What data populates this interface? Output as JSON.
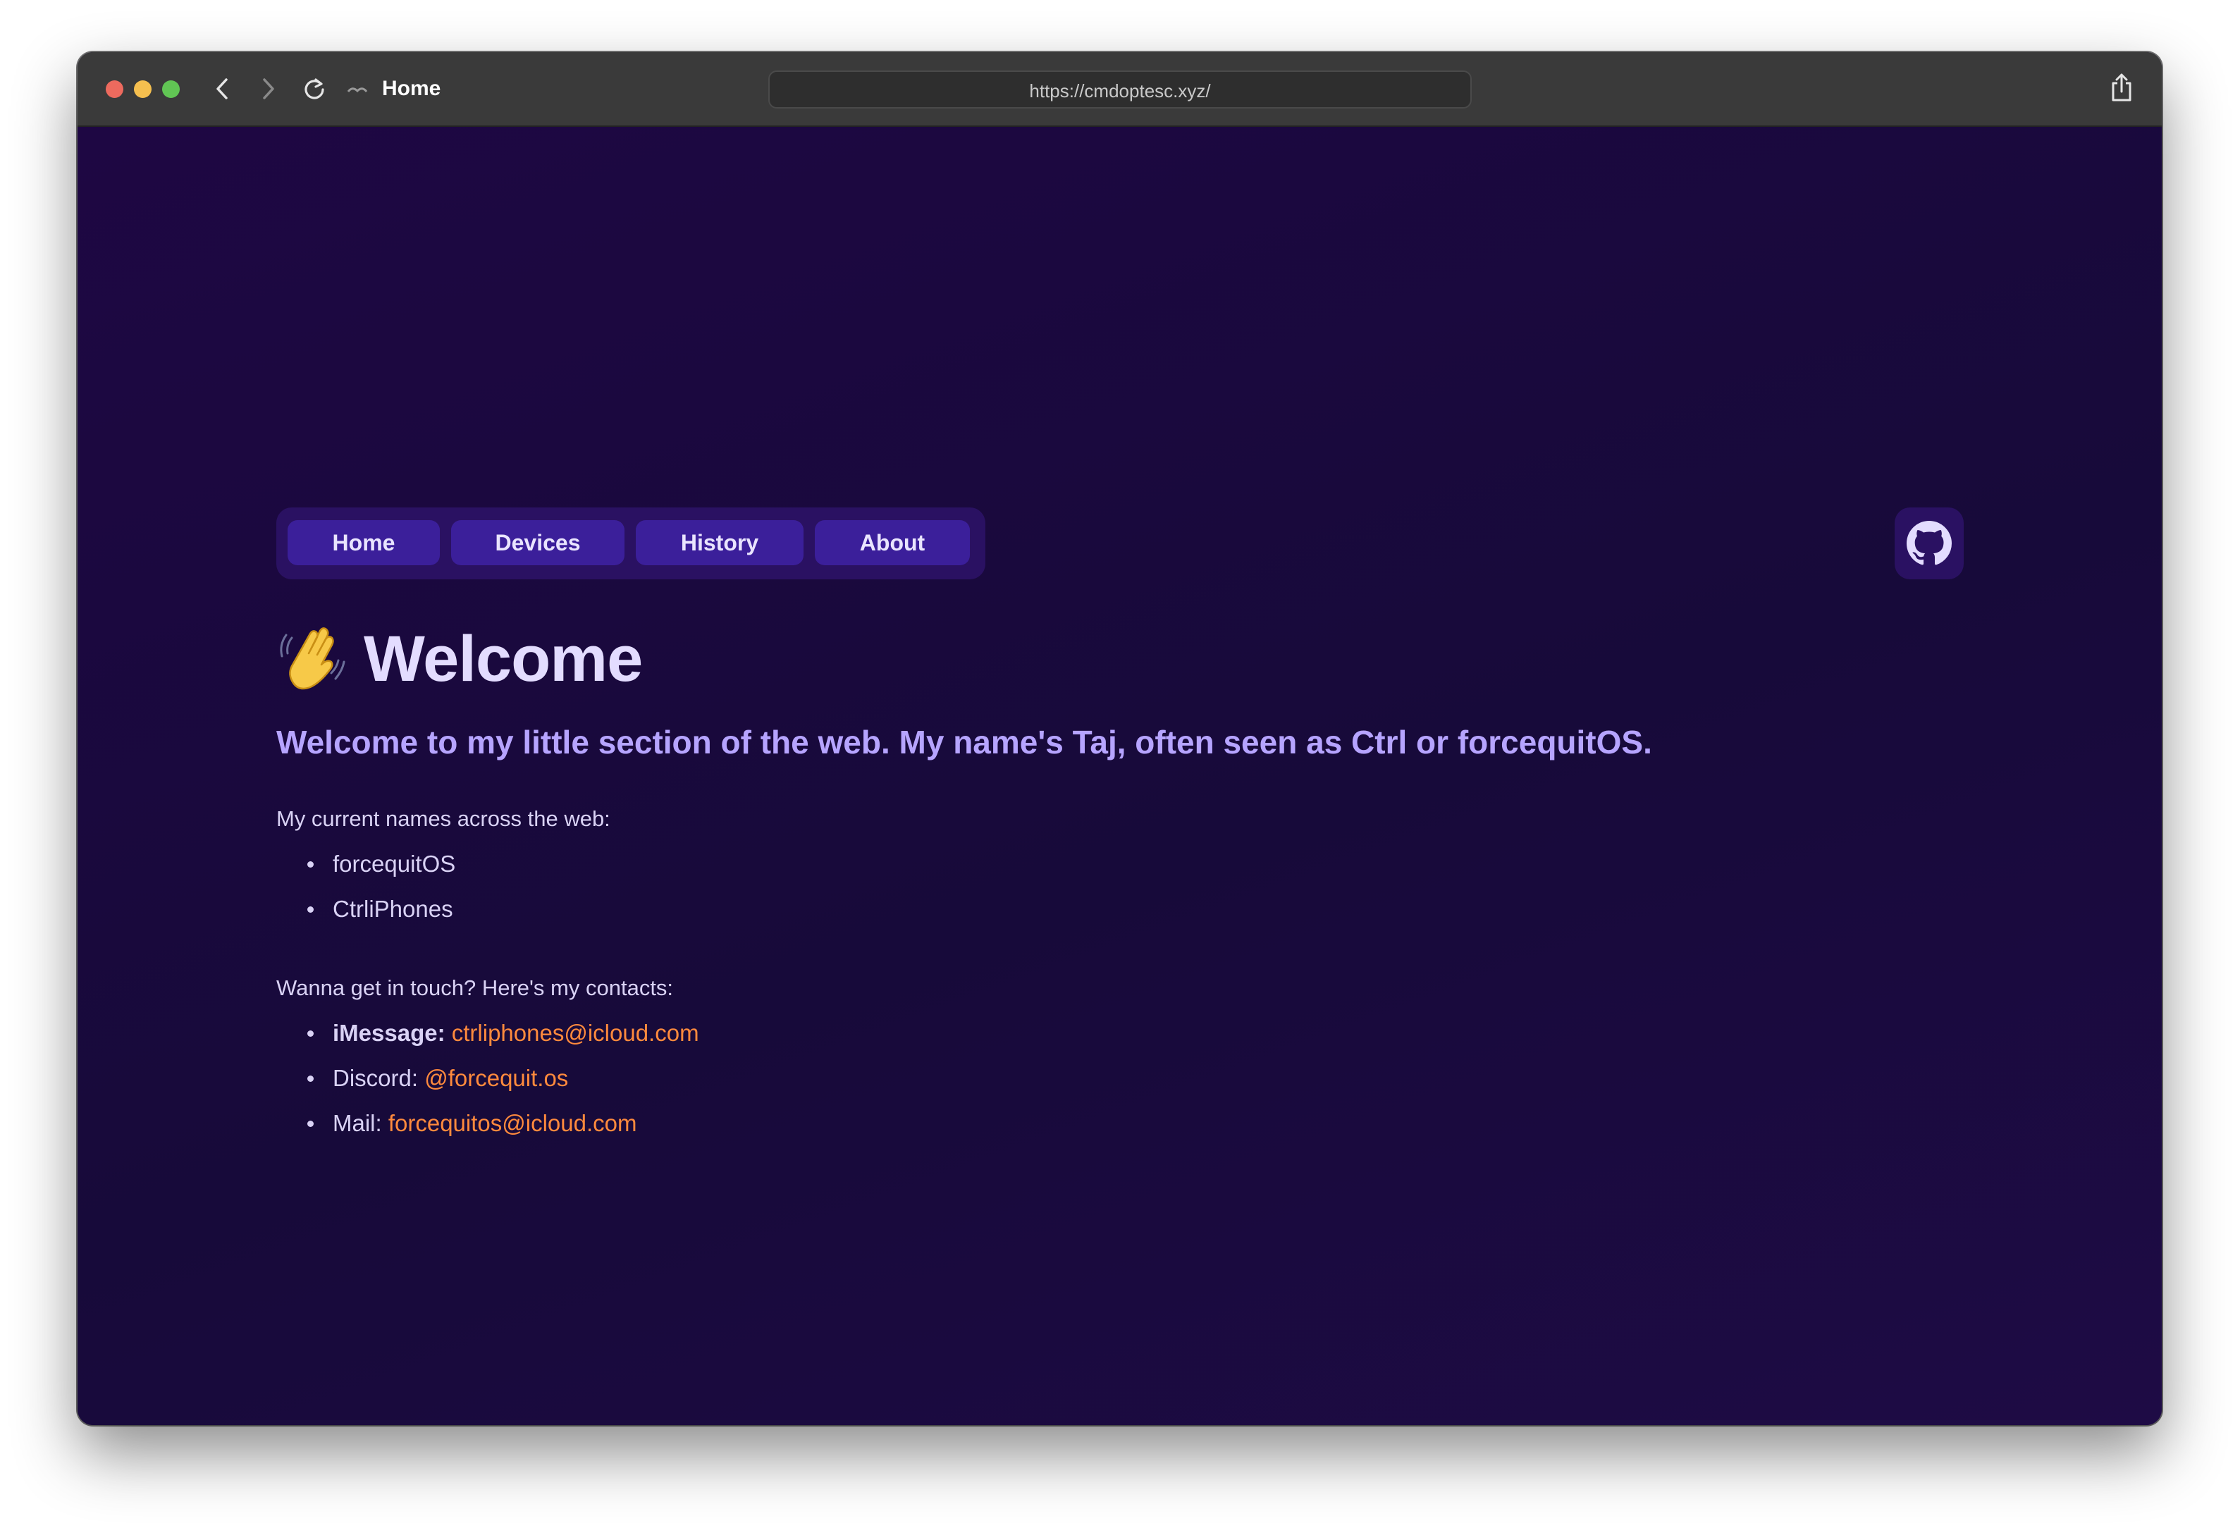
{
  "browser": {
    "tab_title": "Home",
    "url": "https://cmdoptesc.xyz/"
  },
  "nav": {
    "items": [
      "Home",
      "Devices",
      "History",
      "About"
    ]
  },
  "main": {
    "heading": "Welcome",
    "subtitle": "Welcome to my little section of the web. My name's Taj, often seen as Ctrl or forcequitOS.",
    "names_intro": "My current names across the web:",
    "names": [
      "forcequitOS",
      "CtrliPhones"
    ],
    "contacts_intro": "Wanna get in touch? Here's my contacts:",
    "contacts": [
      {
        "label": "iMessage:",
        "value": "ctrliphones@icloud.com"
      },
      {
        "label": "Discord:",
        "value": "@forcequit.os"
      },
      {
        "label": "Mail:",
        "value": "forcequitos@icloud.com"
      }
    ]
  },
  "colors": {
    "background": "#1d0740",
    "nav_button": "#3b1f9a",
    "heading": "#e3dcff",
    "subtitle": "#b6a4ff",
    "link": "#ff8a3d"
  },
  "icons": {
    "heading": "waving-hand-icon",
    "social": "github-icon"
  }
}
